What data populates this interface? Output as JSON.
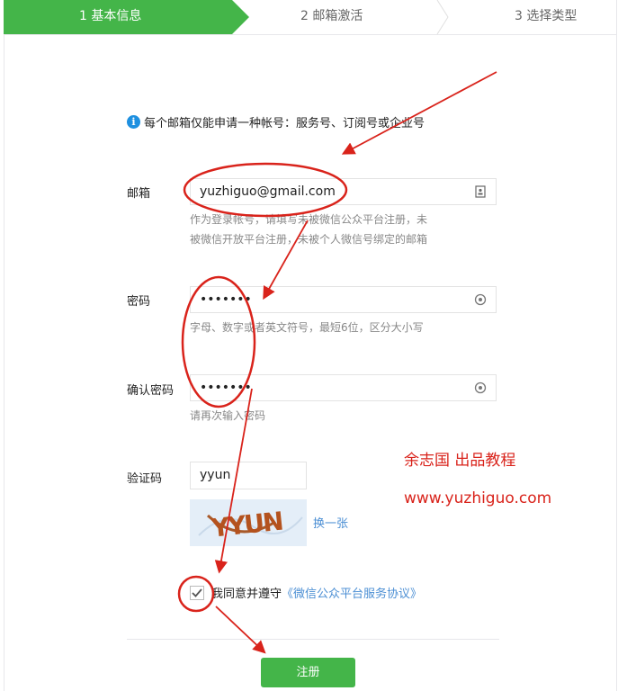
{
  "steps": [
    {
      "label": "1 基本信息",
      "active": true
    },
    {
      "label": "2 邮箱激活",
      "active": false
    },
    {
      "label": "3 选择类型",
      "active": false
    }
  ],
  "notice": "每个邮箱仅能申请一种帐号：服务号、订阅号或企业号",
  "form": {
    "email": {
      "label": "邮箱",
      "value": "yuzhiguo@gmail.com",
      "tip_line1": "作为登录帐号，请填写未被微信公众平台注册，未",
      "tip_line2": "被微信开放平台注册，未被个人微信号绑定的邮箱"
    },
    "password": {
      "label": "密码",
      "value": "•••••••",
      "tip": "字母、数字或者英文符号，最短6位，区分大小写"
    },
    "confirm": {
      "label": "确认密码",
      "value": "•••••••",
      "tip": "请再次输入密码"
    },
    "captcha": {
      "label": "验证码",
      "value": "yyun",
      "image_text": "YYUN",
      "refresh": "换一张"
    },
    "agree": {
      "checked": true,
      "text": "我同意并遵守",
      "link": "《微信公众平台服务协议》"
    },
    "submit": "注册"
  },
  "watermark": {
    "line1": "余志国 出品教程",
    "line2": "www.yuzhiguo.com"
  },
  "colors": {
    "accent": "#44b549",
    "link": "#4c8fd4",
    "annotation": "#d9231b"
  }
}
